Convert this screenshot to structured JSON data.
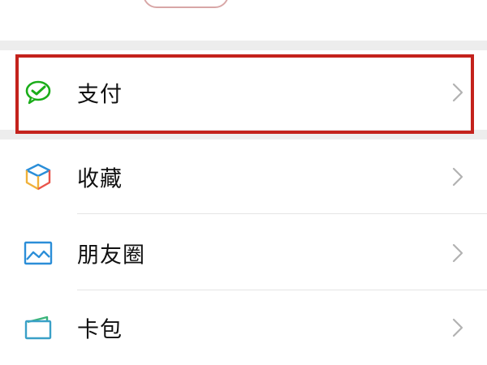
{
  "status": {
    "pill_color": "#d8a7a7"
  },
  "menu": {
    "items": [
      {
        "label": "支付",
        "icon": "wechat-pay-icon",
        "icon_color": "#1aad19",
        "highlighted": true
      },
      {
        "label": "收藏",
        "icon": "favorites-cube-icon",
        "icon_color": "#f0b13a"
      },
      {
        "label": "朋友圈",
        "icon": "moments-picture-icon",
        "icon_color": "#2b8ed8"
      },
      {
        "label": "卡包",
        "icon": "card-wallet-icon",
        "icon_color": "#3aa0c7"
      }
    ]
  },
  "colors": {
    "highlight_border": "#c4221c",
    "section_gap": "#ededed",
    "chevron": "#b2b2b2"
  }
}
